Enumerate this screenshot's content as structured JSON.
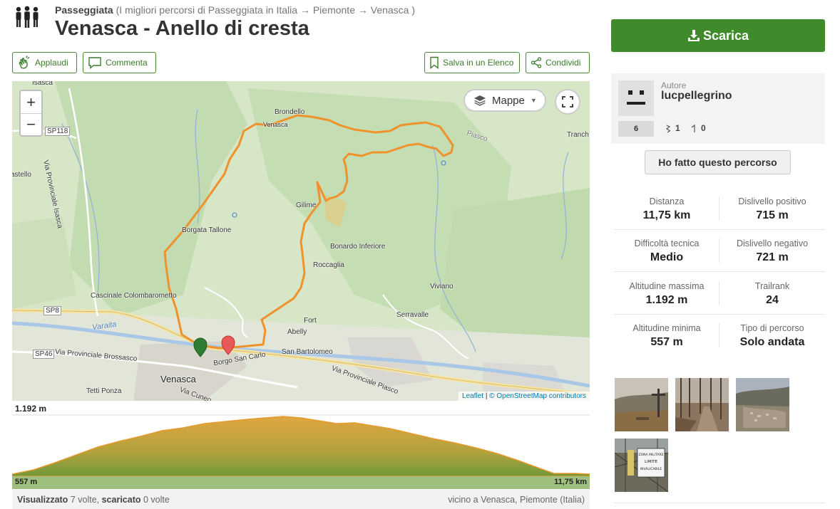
{
  "header": {
    "activity": "Passeggiata",
    "crumb_rest": "(I migliori percorsi di Passeggiata in Italia → Piemonte → Venasca )",
    "title": "Venasca - Anello di cresta"
  },
  "actions": {
    "applaudi": "Applaudi",
    "commenta": "Commenta",
    "salva": "Salva in un Elenco",
    "condividi": "Condividi"
  },
  "map": {
    "layer_label": "Mappe",
    "zoom_in": "+",
    "zoom_out": "−",
    "attribution_leaflet": "Leaflet",
    "attribution_sep": "|",
    "attribution_osm": "© OpenStreetMap contributors",
    "labels": {
      "isasca": "Isasca",
      "sp118": "SP118",
      "castello": "astello",
      "via_prov_isasca": "Via Provinciale Isasca",
      "brondello": "Brondello",
      "venasca_top": "Venasca",
      "piasco_top": "Piasco",
      "tranch": "Tranch",
      "gilime": "Gilime",
      "borgata_tallone": "Borgata Tallone",
      "bonardo": "Bonardo Inferiore",
      "roccaglia": "Roccaglia",
      "viviano": "Viviano",
      "cascinale": "Cascinale Colombarometto",
      "sp8": "SP8",
      "varaita": "Varaita",
      "fort": "Fort",
      "abelly": "Abelly",
      "serravalle": "Serravalle",
      "sp46": "SP46",
      "via_prov_brossasco": "Via Provinciale Brossasco",
      "borgo": "Borgo San Carlo",
      "san_bartolomeo": "San Bartolomeo",
      "via_prov_piasco": "Via Provinciale Piasco",
      "tetti_ponza": "Tetti Ponza",
      "venasca": "Venasca",
      "via_cuneo": "Via Cuneo"
    }
  },
  "elevation": {
    "max_label": "1.192 m",
    "min_label": "557 m",
    "distance_label": "11,75 km"
  },
  "footer": {
    "viewed_label": "Visualizzato",
    "viewed_text": "7 volte,",
    "downloaded_label": "scaricato",
    "downloaded_text": "0 volte",
    "location": "vicino a Venasca, Piemonte (Italia)"
  },
  "sidebar": {
    "download_label": "Scarica",
    "author_caption": "Autore",
    "author_name": "lucpellegrino",
    "trailrank_badge": "6",
    "followers": "1",
    "trails": "0",
    "done_button": "Ho fatto questo percorso",
    "stats": [
      {
        "label": "Distanza",
        "value": "11,75 km"
      },
      {
        "label": "Dislivello positivo",
        "value": "715 m"
      },
      {
        "label": "Difficoltà tecnica",
        "value": "Medio"
      },
      {
        "label": "Dislivello negativo",
        "value": "721 m"
      },
      {
        "label": "Altitudine massima",
        "value": "1.192 m"
      },
      {
        "label": "Trailrank",
        "value": "24"
      },
      {
        "label": "Altitudine minima",
        "value": "557 m"
      },
      {
        "label": "Tipo di percorso",
        "value": "Solo andata"
      }
    ]
  },
  "photos": {
    "zona_sign_line1": "ZONA MILITARE",
    "zona_sign_line2": "LIMITE",
    "zona_sign_line3": "INVALICABILE"
  },
  "colors": {
    "brand_green": "#3f8a2b",
    "track_orange": "#f0922b",
    "start_marker": "#2e7d32",
    "end_marker": "#e85a5a",
    "elevation_fill": "#8a9a3a"
  },
  "icons": {
    "logo": "walking-people-icon",
    "applaudi": "clap-hands-icon",
    "commenta": "comment-icon",
    "salva": "bookmark-icon",
    "condividi": "share-icon",
    "layers": "layers-icon",
    "fullscreen": "fullscreen-icon",
    "download": "download-icon"
  }
}
